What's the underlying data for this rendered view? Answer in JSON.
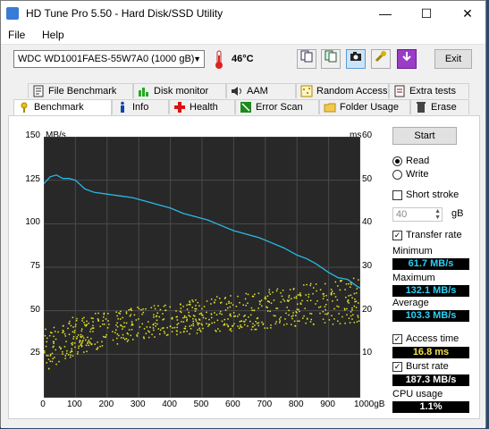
{
  "window": {
    "title": "HD Tune Pro 5.50 - Hard Disk/SSD Utility",
    "minimize": "—",
    "maximize": "☐",
    "close": "✕"
  },
  "menu": {
    "file": "File",
    "help": "Help"
  },
  "toolbar": {
    "drive": "WDC WD1001FAES-55W7A0 (1000 gB)",
    "temperature": "46°C",
    "exit": "Exit"
  },
  "tabs_top": [
    {
      "label": "File Benchmark",
      "icon": "file-benchmark-icon"
    },
    {
      "label": "Disk monitor",
      "icon": "disk-monitor-icon"
    },
    {
      "label": "AAM",
      "icon": "speaker-icon"
    },
    {
      "label": "Random Access",
      "icon": "random-access-icon"
    },
    {
      "label": "Extra tests",
      "icon": "extra-tests-icon"
    }
  ],
  "tabs_bottom": [
    {
      "label": "Benchmark",
      "icon": "benchmark-icon",
      "active": true
    },
    {
      "label": "Info",
      "icon": "info-icon"
    },
    {
      "label": "Health",
      "icon": "health-cross-icon"
    },
    {
      "label": "Error Scan",
      "icon": "error-scan-icon"
    },
    {
      "label": "Folder Usage",
      "icon": "folder-icon"
    },
    {
      "label": "Erase",
      "icon": "erase-icon"
    }
  ],
  "side": {
    "start": "Start",
    "read": "Read",
    "write": "Write",
    "short_stroke": "Short stroke",
    "stroke_value": "40",
    "stroke_unit": "gB",
    "transfer_rate": "Transfer rate",
    "minimum_label": "Minimum",
    "minimum": "61.7 MB/s",
    "maximum_label": "Maximum",
    "maximum": "132.1 MB/s",
    "average_label": "Average",
    "average": "103.3 MB/s",
    "access_time": "Access time",
    "access_value": "16.8 ms",
    "burst_rate": "Burst rate",
    "burst_value": "187.3 MB/s",
    "cpu_label": "CPU usage",
    "cpu_value": "1.1%"
  },
  "colors": {
    "transfer_line": "#2ab8e8",
    "access_points": "#e6e62a",
    "chart_bg": "#282828",
    "grid": "#4a4a4a"
  },
  "chart_data": {
    "type": "line",
    "y_left_label": "MB/s",
    "y_right_label": "ms",
    "x_unit": "gB",
    "ylim_left": [
      0,
      150
    ],
    "ylim_right": [
      0,
      60
    ],
    "xlim": [
      0,
      1000
    ],
    "y_left_ticks": [
      "150",
      "125",
      "100",
      "75",
      "50",
      "25"
    ],
    "y_right_ticks": [
      "60",
      "50",
      "40",
      "30",
      "20",
      "10"
    ],
    "x_ticks": [
      "0",
      "100",
      "200",
      "300",
      "400",
      "500",
      "600",
      "700",
      "800",
      "900",
      "1000gB"
    ],
    "grid": true,
    "series": [
      {
        "name": "Transfer rate",
        "x": [
          0,
          20,
          40,
          60,
          80,
          100,
          130,
          160,
          200,
          240,
          280,
          320,
          360,
          400,
          440,
          480,
          520,
          560,
          600,
          640,
          680,
          720,
          760,
          800,
          830,
          860,
          900,
          930,
          960,
          990,
          1000
        ],
        "y": [
          123,
          127,
          128,
          126,
          126,
          125,
          120,
          118,
          117,
          116,
          115,
          113,
          111,
          109,
          106,
          104,
          102,
          99,
          96,
          94,
          92,
          89,
          86,
          82,
          80,
          77,
          72,
          69,
          68,
          64,
          63
        ]
      }
    ],
    "access_scatter": {
      "name": "Access time",
      "band_low": [
        6,
        10,
        12,
        13.5,
        14.5,
        15,
        15.5,
        16,
        16.5,
        17,
        17.5
      ],
      "band_high": [
        16,
        19,
        20,
        21,
        22,
        23,
        24,
        25,
        26,
        27,
        28
      ]
    }
  }
}
